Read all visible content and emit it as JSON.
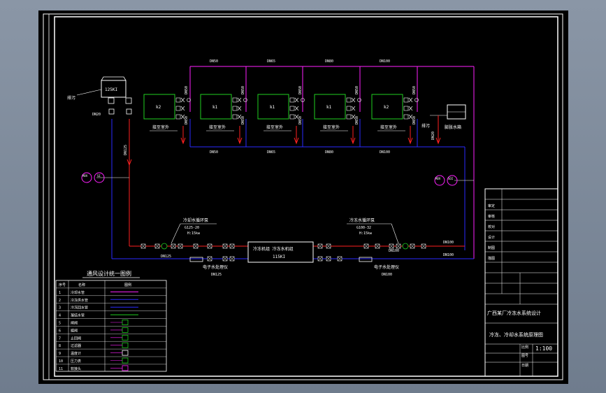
{
  "drawing": {
    "background": "#000000",
    "colors": {
      "frame": "#ffffff",
      "supply_pipe": "#ff2020",
      "return_pipe": "#2a2aff",
      "condensate_pipe": "#ff20ff",
      "equipment": "#20d020",
      "text": "#ffffff",
      "text_alt": "#d8d8d8"
    },
    "pipe_labels": {
      "top": [
        "DN50",
        "DN65",
        "DN80",
        "DN100"
      ],
      "bottom": [
        "DN50",
        "DN65",
        "DN80",
        "DN100"
      ],
      "vertical_labels": [
        "DN50",
        "DN50",
        "DN50",
        "DN50",
        "DN50",
        "DN50",
        "DN50",
        "DN50"
      ],
      "left_dn20": "DN20",
      "right_dn20": "DN20",
      "left_riser": "DN125",
      "bottom_left_a": "DN125",
      "bottom_left_b": "DN125",
      "bottom_right_a": "DN100",
      "bottom_right_b": "DN100",
      "right_riser_a": "DN100",
      "right_riser_b": "DN100"
    },
    "units": [
      {
        "name": "k2",
        "caption": "接至室外"
      },
      {
        "name": "k1",
        "caption": "接至室外"
      },
      {
        "name": "k1",
        "caption": "接至室外"
      },
      {
        "name": "k1",
        "caption": "接至室外"
      },
      {
        "name": "k2",
        "caption": "接至室外"
      }
    ],
    "cooling_tower": {
      "label": "125KI",
      "valve_label": "排污"
    },
    "expansion_tank": {
      "label": "膨胀水箱",
      "valve_label": "排污"
    },
    "gauges_left": [
      "MOV",
      "SI"
    ],
    "gauges_right": [
      "MOV",
      "SOI"
    ],
    "pumps_left": {
      "title": "冷却水循环泵",
      "spec1": "G125-20",
      "spec2": "H:15kw"
    },
    "pumps_right": {
      "title": "冷冻水循环泵",
      "spec1": "G100-32",
      "spec2": "H:15kw"
    },
    "chiller": {
      "line1": "冷冻机组 冷冻水机组",
      "line2": "115KI"
    },
    "water_treat_left": "电子水处理仪",
    "water_treat_right": "电子水处理仪",
    "legend": {
      "title": "通风设计统一图例",
      "col_headers": [
        "序号",
        "名称",
        "图例"
      ],
      "rows": [
        {
          "no": "1",
          "name": "冷却水管"
        },
        {
          "no": "2",
          "name": "冷冻供水管"
        },
        {
          "no": "3",
          "name": "冷冻回水管"
        },
        {
          "no": "4",
          "name": "凝结水管"
        },
        {
          "no": "5",
          "name": "闸阀"
        },
        {
          "no": "6",
          "name": "蝶阀"
        },
        {
          "no": "7",
          "name": "止回阀"
        },
        {
          "no": "8",
          "name": "过滤器"
        },
        {
          "no": "9",
          "name": "温度计"
        },
        {
          "no": "10",
          "name": "压力表"
        },
        {
          "no": "11",
          "name": "软接头"
        }
      ]
    },
    "title_block": {
      "left_labels": [
        "审定",
        "审核",
        "校对",
        "设计",
        "制图",
        "描图"
      ],
      "project": "广西某厂冷冻水系统设计",
      "drawing_name": "冷冻、冷却水系统原理图",
      "scale": "1:100",
      "label_scale": "比例",
      "label_drawing_no": "图号",
      "label_date": "日期"
    }
  }
}
